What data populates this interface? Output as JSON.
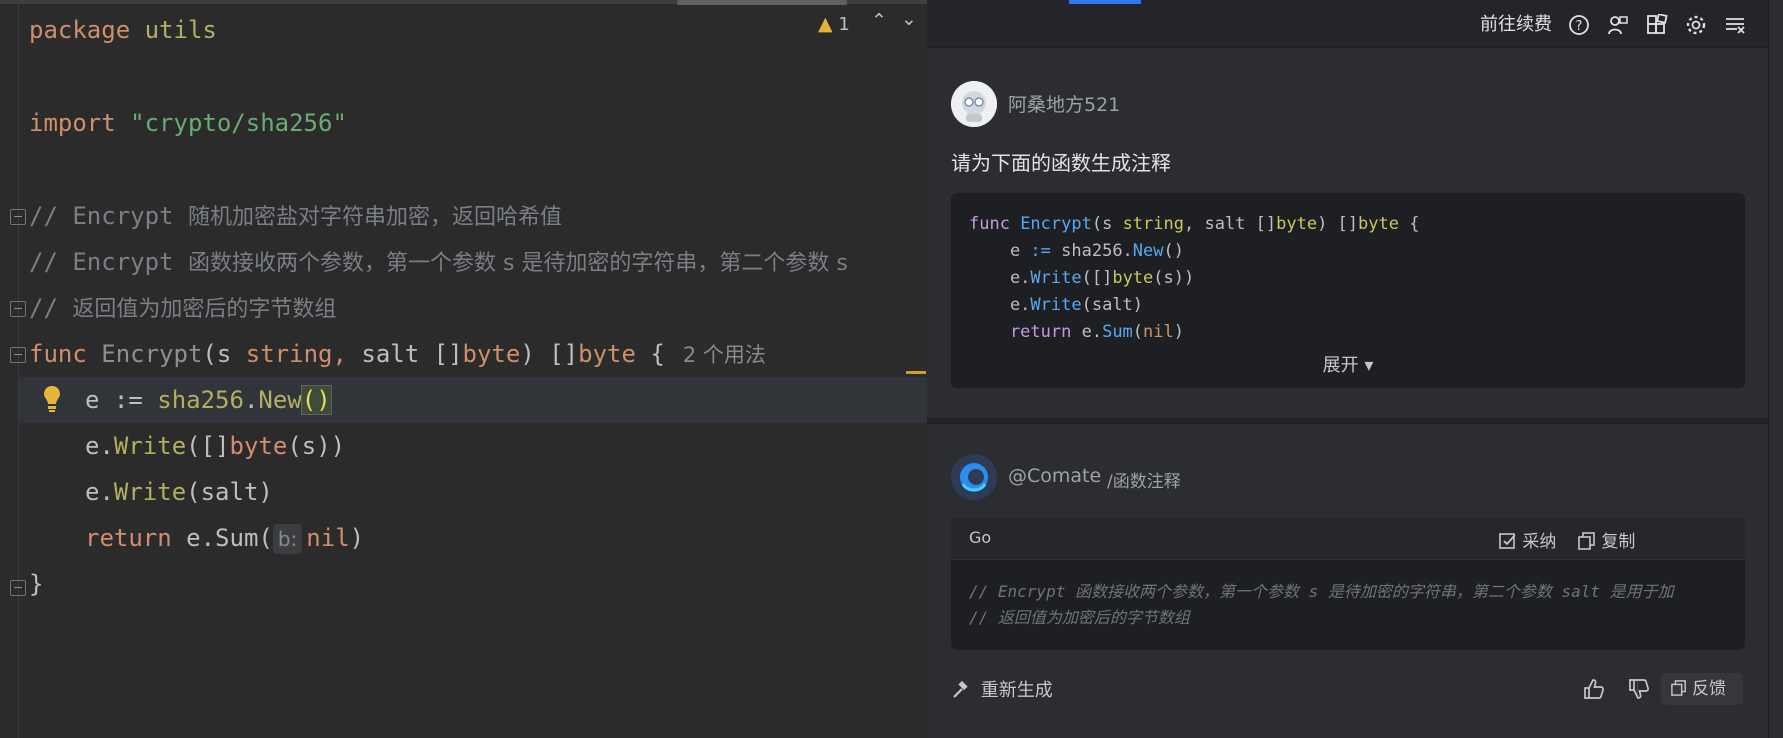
{
  "editor": {
    "lines": {
      "l1": {
        "kw": "package",
        "name": "utils"
      },
      "l3": {
        "kw": "import",
        "path": "\"crypto/sha256\""
      },
      "l5": {
        "prefix": "// Encrypt ",
        "text": "随机加密盐对字符串加密，返回哈希值"
      },
      "l6": {
        "prefix": "// Encrypt ",
        "text": "函数接收两个参数，第一个参数 s 是待加密的字符串，第二个参数 s"
      },
      "l7": {
        "prefix": "// ",
        "text": "返回值为加密后的字节数组"
      },
      "l8": {
        "func": "func",
        "name": "Encrypt",
        "p_open": "(",
        "s": "s",
        "string": "string,",
        "salt": " salt ",
        "brackets1": "[]",
        "byte1": "byte",
        "close": ") ",
        "brackets2": "[]",
        "byte2": "byte",
        "brace": " {",
        "usages": "2 个用法"
      },
      "l9": {
        "e": "e := ",
        "pkg": "sha256",
        "dot": ".",
        "call": "New",
        "parens": "()"
      },
      "l10": {
        "pre": "e.",
        "call": "Write",
        "a": "([]",
        "ty": "byte",
        "b": "(s))"
      },
      "l11": {
        "pre": "e.",
        "call": "Write",
        "a": "(salt)"
      },
      "l12": {
        "kw": "return",
        "pre": " e.Sum(",
        "hint": "b:",
        "nil": "nil",
        "end": ")"
      },
      "l13": {
        "brace": "}"
      }
    },
    "inspection": {
      "count": "1"
    }
  },
  "panel": {
    "topbar": {
      "renew_label": "前往续费"
    },
    "user": {
      "name": "阿桑地方521",
      "prompt": "请为下面的函数生成注释"
    },
    "user_code": {
      "line1": {
        "kw": "func",
        "name": " Encrypt",
        "a": "(s ",
        "ty1": "string",
        "b": ", salt []",
        "ty2": "byte",
        "c": ") []",
        "ty3": "byte",
        "d": " {"
      },
      "line2": {
        "a": "    e ",
        "op": ":=",
        "b": " sha256.",
        "fn": "New",
        "c": "()"
      },
      "line3": {
        "a": "    e.",
        "fn": "Write",
        "b": "([]",
        "ty": "byte",
        "c": "(s))"
      },
      "line4": {
        "a": "    e.",
        "fn": "Write",
        "b": "(salt)"
      },
      "line5": {
        "kw": "    return",
        "a": " e.",
        "fn": "Sum",
        "b": "(",
        "nil": "nil",
        "c": ")"
      },
      "expand_label": "展开 ▾"
    },
    "bot": {
      "name": "@Comate",
      "command": "/函数注释"
    },
    "answer": {
      "language": "Go",
      "adopt_label": "采纳",
      "copy_label": "复制",
      "lines": [
        "// Encrypt 函数接收两个参数，第一个参数 s 是待加密的字符串，第二个参数 salt 是用于加",
        "// 返回值为加密后的字节数组"
      ]
    },
    "actions": {
      "regenerate_label": "重新生成",
      "feedback_label": "反馈"
    }
  },
  "colors": {
    "accent": "#3574f0",
    "warning": "#e0b43b",
    "keyword": "#cf8e6d",
    "string": "#6aab73"
  }
}
